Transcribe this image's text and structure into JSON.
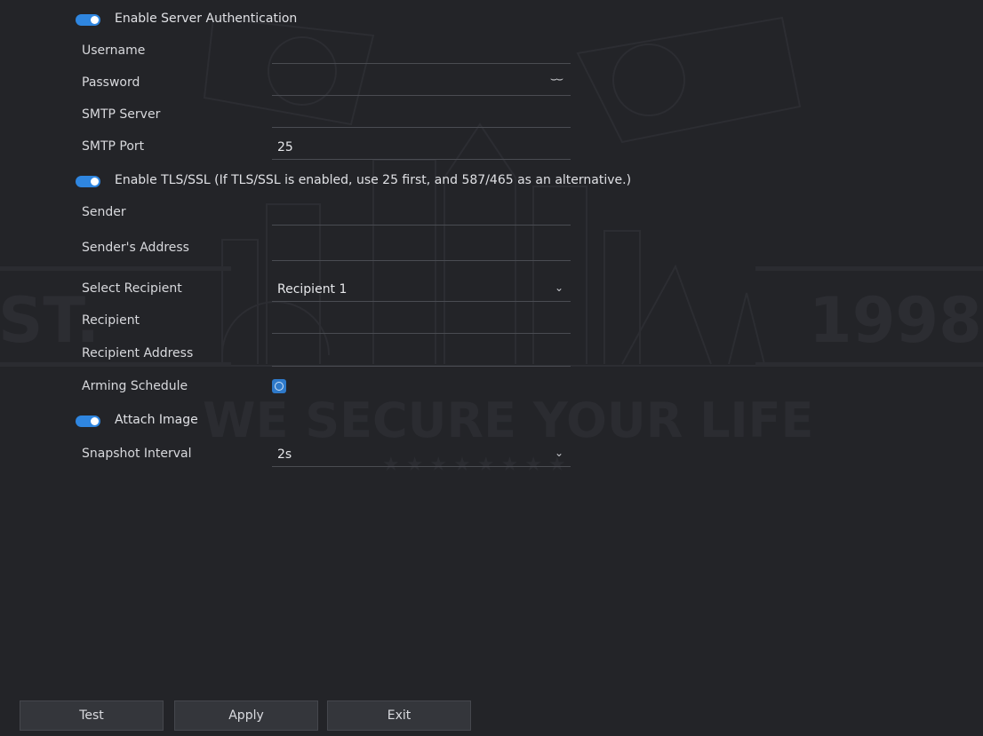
{
  "form": {
    "enable_server_auth": {
      "label": "Enable Server Authentication",
      "enabled": true
    },
    "username": {
      "label": "Username",
      "value": ""
    },
    "password": {
      "label": "Password",
      "value": ""
    },
    "smtp_server": {
      "label": "SMTP Server",
      "value": ""
    },
    "smtp_port": {
      "label": "SMTP Port",
      "value": "25"
    },
    "enable_tls": {
      "label": "Enable TLS/SSL (If TLS/SSL is enabled, use 25 first, and 587/465 as an alternative.)",
      "enabled": true
    },
    "sender": {
      "label": "Sender",
      "value": ""
    },
    "sender_address": {
      "label": "Sender's Address",
      "value": ""
    },
    "select_recipient": {
      "label": "Select Recipient",
      "value": "Recipient 1"
    },
    "recipient": {
      "label": "Recipient",
      "value": ""
    },
    "recipient_address": {
      "label": "Recipient Address",
      "value": ""
    },
    "arming_schedule": {
      "label": "Arming Schedule",
      "icon": "schedule-settings-icon"
    },
    "attach_image": {
      "label": "Attach Image",
      "enabled": true
    },
    "snapshot_interval": {
      "label": "Snapshot Interval",
      "value": "2s"
    }
  },
  "buttons": {
    "test": "Test",
    "apply": "Apply",
    "exit": "Exit"
  },
  "watermark": {
    "tagline": "WE SECURE YOUR LIFE",
    "left_text": "ST.",
    "year": "1998"
  },
  "colors": {
    "background": "#232428",
    "toggle_on": "#2f86e0",
    "text": "#d8d9dd"
  }
}
